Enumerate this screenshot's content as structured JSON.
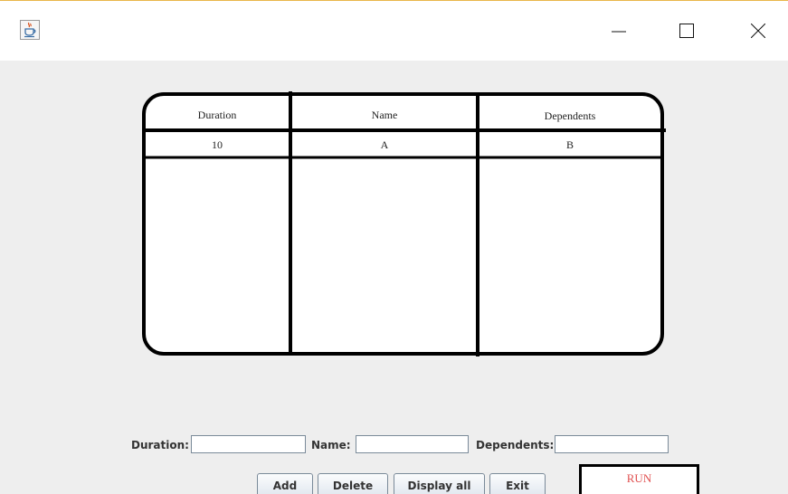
{
  "window": {
    "icon": "java-cup-icon",
    "controls": [
      "minimize-icon",
      "maximize-icon",
      "close-icon"
    ]
  },
  "table": {
    "headers": [
      "Duration",
      "Name",
      "Dependents"
    ],
    "rows": [
      [
        "10",
        "A",
        "B"
      ]
    ]
  },
  "form": {
    "duration_label": "Duration:",
    "duration_value": "",
    "name_label": "Name:",
    "name_value": "",
    "dependents_label": "Dependents:",
    "dependents_value": ""
  },
  "buttons": {
    "add": "Add",
    "delete": "Delete",
    "display_all": "Display all",
    "exit": "Exit",
    "run": "RUN"
  },
  "colors": {
    "run_text": "#e05050",
    "window_border": "#e9b64a"
  }
}
